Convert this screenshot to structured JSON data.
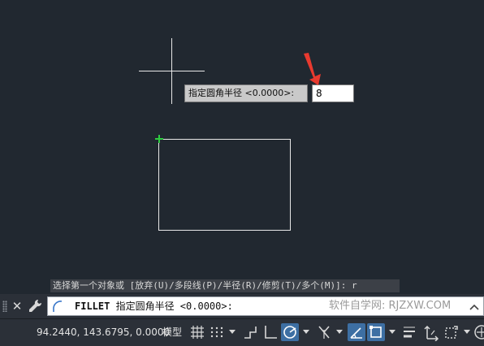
{
  "canvas": {
    "tooltip_label": "指定圆角半径 <0.0000>:",
    "tooltip_input_value": "8",
    "history_text": "选择第一个对象或 [放弃(U)/多段线(P)/半径(R)/修剪(T)/多个(M)]: r",
    "colors": {
      "background": "#212830",
      "arrow": "#e83a2f",
      "marker": "#2ecc40"
    }
  },
  "command_line": {
    "command_name": "FILLET",
    "prompt_text": " 指定圆角半径 <0.0000>:",
    "watermark": "软件自学网: RJZXW.COM",
    "close_glyph": "✕"
  },
  "status_bar": {
    "coordinates": "94.2440, 143.6795, 0.0000",
    "model_label": "模型",
    "icons": [
      "grid-icon",
      "snap-icon",
      "ortho-icon",
      "polar-icon",
      "isodraft-icon",
      "osnap-track-icon",
      "dynamic-ucs-icon",
      "selection-cycling-icon",
      "lineweight-icon",
      "annotation-icon",
      "workspace-icon",
      "hardware-accel-icon"
    ]
  }
}
